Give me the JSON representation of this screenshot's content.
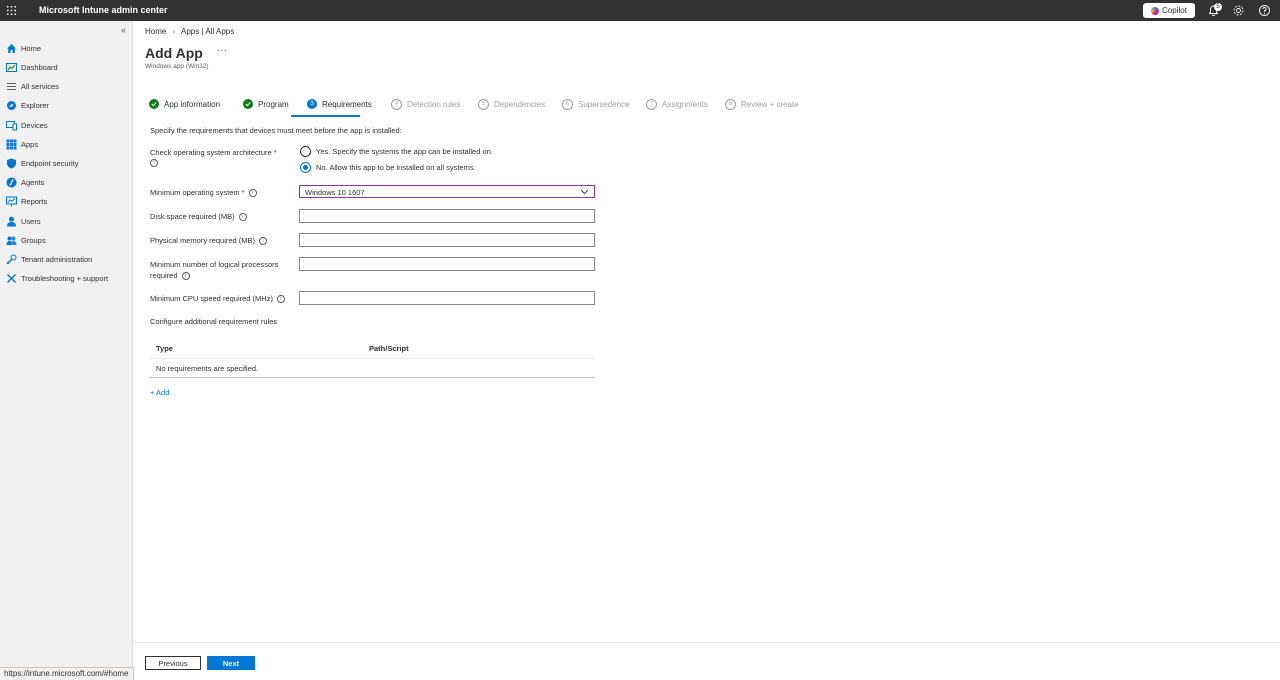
{
  "app": {
    "title": "Microsoft Intune admin center",
    "copilot_label": "Copilot",
    "notification_count": "5"
  },
  "sidebar": {
    "items": [
      {
        "label": "Home",
        "icon": "home-icon"
      },
      {
        "label": "Dashboard",
        "icon": "dashboard-icon"
      },
      {
        "label": "All services",
        "icon": "all-services-icon"
      },
      {
        "label": "Explorer",
        "icon": "explorer-icon"
      },
      {
        "label": "Devices",
        "icon": "devices-icon"
      },
      {
        "label": "Apps",
        "icon": "apps-icon"
      },
      {
        "label": "Endpoint security",
        "icon": "endpoint-security-icon"
      },
      {
        "label": "Agents",
        "icon": "agents-icon"
      },
      {
        "label": "Reports",
        "icon": "reports-icon"
      },
      {
        "label": "Users",
        "icon": "users-icon"
      },
      {
        "label": "Groups",
        "icon": "groups-icon"
      },
      {
        "label": "Tenant administration",
        "icon": "tenant-admin-icon"
      },
      {
        "label": "Troubleshooting + support",
        "icon": "troubleshooting-icon"
      }
    ]
  },
  "breadcrumb": {
    "home": "Home",
    "apps": "Apps | All Apps",
    "separator": "›"
  },
  "page": {
    "title": "Add App",
    "subtitle": "Windows app (Win32)",
    "more": "···"
  },
  "steps": [
    {
      "label": "App information",
      "state": "done"
    },
    {
      "label": "Program",
      "state": "done"
    },
    {
      "label": "Requirements",
      "state": "current",
      "number": "3"
    },
    {
      "label": "Detection rules",
      "state": "pending",
      "number": "4"
    },
    {
      "label": "Dependencies",
      "state": "pending",
      "number": "5"
    },
    {
      "label": "Supersedence",
      "state": "pending",
      "number": "6"
    },
    {
      "label": "Assignments",
      "state": "pending",
      "number": "7"
    },
    {
      "label": "Review + create",
      "state": "pending",
      "number": "8"
    }
  ],
  "form": {
    "intro": "Specify the requirements that devices must meet before the app is installed:",
    "arch_label": "Check operating system architecture",
    "arch_options": [
      {
        "label": "Yes. Specify the systems the app can be installed on.",
        "selected": false
      },
      {
        "label": "No. Allow this app to be installed on all systems.",
        "selected": true
      }
    ],
    "min_os_label": "Minimum operating system",
    "min_os_value": "Windows 10 1607",
    "disk_label": "Disk space required (MB)",
    "memory_label": "Physical memory required (MB)",
    "processors_label_1": "Minimum number of logical processors",
    "processors_label_2": "required",
    "cpu_label": "Minimum CPU speed required (MHz)",
    "required_mark": "*",
    "info_glyph": "i"
  },
  "rules": {
    "title": "Configure additional requirement rules",
    "columns": [
      "Type",
      "Path/Script"
    ],
    "empty": "No requirements are specified.",
    "add_label": "+ Add"
  },
  "footer": {
    "previous": "Previous",
    "next": "Next"
  },
  "status_url": "https://intune.microsoft.com/#home",
  "colors": {
    "accent": "#0078d4",
    "success": "#107c10",
    "topbar": "#323232",
    "select_border": "#8c3a99"
  }
}
